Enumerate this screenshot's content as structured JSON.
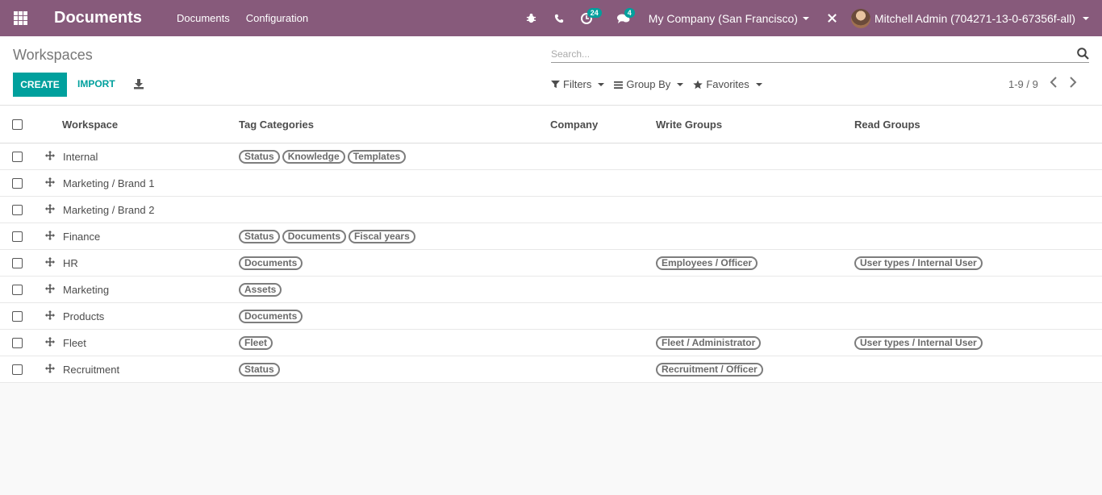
{
  "navbar": {
    "app_title": "Documents",
    "menu": [
      "Documents",
      "Configuration"
    ],
    "activity_count": "24",
    "message_count": "4",
    "company": "My Company (San Francisco)",
    "user": "Mitchell Admin (704271-13-0-67356f-all)"
  },
  "control": {
    "breadcrumb": "Workspaces",
    "search_placeholder": "Search...",
    "create_label": "CREATE",
    "import_label": "IMPORT",
    "filters_label": "Filters",
    "groupby_label": "Group By",
    "favorites_label": "Favorites",
    "pager": "1-9 / 9"
  },
  "table": {
    "headers": [
      "Workspace",
      "Tag Categories",
      "Company",
      "Write Groups",
      "Read Groups"
    ],
    "rows": [
      {
        "workspace": "Internal",
        "tags": [
          "Status",
          "Knowledge",
          "Templates"
        ],
        "write": [],
        "read": []
      },
      {
        "workspace": "Marketing / Brand 1",
        "tags": [],
        "write": [],
        "read": []
      },
      {
        "workspace": "Marketing / Brand 2",
        "tags": [],
        "write": [],
        "read": []
      },
      {
        "workspace": "Finance",
        "tags": [
          "Status",
          "Documents",
          "Fiscal years"
        ],
        "write": [],
        "read": []
      },
      {
        "workspace": "HR",
        "tags": [
          "Documents"
        ],
        "write": [
          "Employees / Officer"
        ],
        "read": [
          "User types / Internal User"
        ]
      },
      {
        "workspace": "Marketing",
        "tags": [
          "Assets"
        ],
        "write": [],
        "read": []
      },
      {
        "workspace": "Products",
        "tags": [
          "Documents"
        ],
        "write": [],
        "read": []
      },
      {
        "workspace": "Fleet",
        "tags": [
          "Fleet"
        ],
        "write": [
          "Fleet / Administrator"
        ],
        "read": [
          "User types / Internal User"
        ]
      },
      {
        "workspace": "Recruitment",
        "tags": [
          "Status"
        ],
        "write": [
          "Recruitment / Officer"
        ],
        "read": []
      }
    ]
  },
  "colors": {
    "navbar": "#875a7b",
    "accent": "#00a09d"
  }
}
